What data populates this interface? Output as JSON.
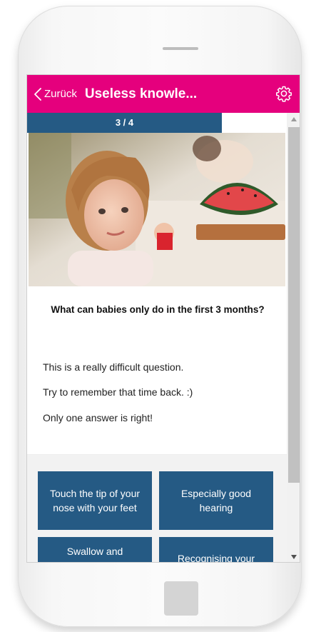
{
  "header": {
    "back_label": "Zurück",
    "title": "Useless knowle...",
    "background": "#e5007d"
  },
  "icons": {
    "back": "chevron-left-icon",
    "settings": "gear-icon",
    "scroll_up": "arrow-up-icon",
    "scroll_down": "arrow-down-icon"
  },
  "progress": {
    "label": "3 / 4",
    "current": 3,
    "total": 4,
    "fraction": 0.75,
    "color": "#255a84"
  },
  "question": "What can babies only do in the first 3 months?",
  "description": [
    "This is a really difficult question.",
    "Try to remember that time back. :)",
    "Only one answer is right!"
  ],
  "answers": [
    "Touch the tip of your nose with your feet",
    "Especially good hearing",
    "Swallow and",
    "Recognising your"
  ],
  "answer_color": "#255a84"
}
